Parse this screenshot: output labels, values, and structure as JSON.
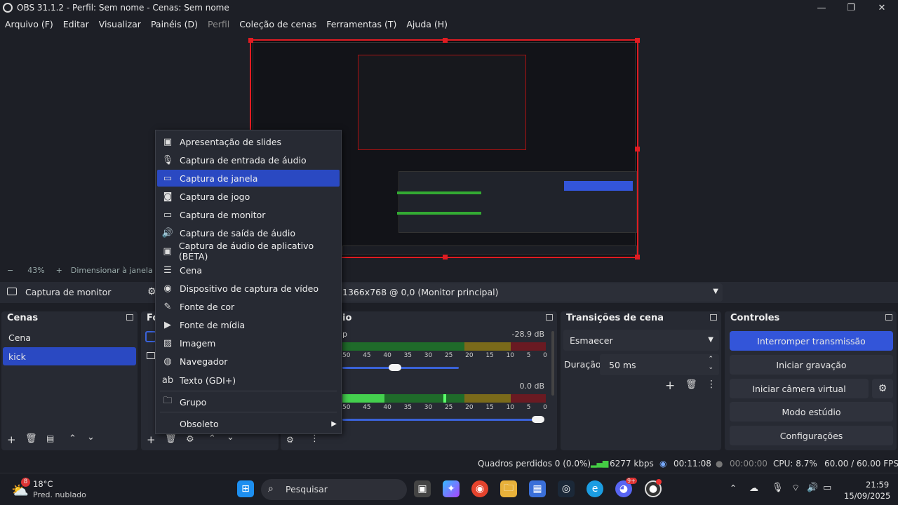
{
  "window": {
    "title": "OBS 31.1.2 - Perfil: Sem nome - Cenas: Sem nome"
  },
  "menubar": [
    "Arquivo (F)",
    "Editar",
    "Visualizar",
    "Painéis (D)",
    "Perfil",
    "Coleção de cenas",
    "Ferramentas (T)",
    "Ajuda (H)"
  ],
  "zoom": {
    "minus": "−",
    "percent": "43%",
    "plus": "+",
    "fit_label": "Dimensionar à janela"
  },
  "source_bar": {
    "source_name": "Captura de monitor",
    "monitor": "1366x768 @ 0,0 (Monitor principal)"
  },
  "scenes": {
    "title": "Cenas",
    "items": [
      "Cena",
      "kick"
    ],
    "selected": "kick"
  },
  "sources": {
    "title": "Fo"
  },
  "mixer": {
    "title": "io",
    "tracks": [
      {
        "name": "p",
        "db": "-28.9 dB",
        "volume": 0.35
      },
      {
        "name": "",
        "db": "0.0 dB",
        "volume": 1.0
      }
    ],
    "scale": [
      "50",
      "45",
      "40",
      "35",
      "30",
      "25",
      "20",
      "15",
      "10",
      "5",
      "0"
    ]
  },
  "transitions": {
    "title": "Transições de cena",
    "selected": "Esmaecer",
    "duration_label": "Duração",
    "duration_value": "50 ms"
  },
  "controls": {
    "title": "Controles",
    "buttons": [
      "Interromper transmissão",
      "Iniciar gravação",
      "Iniciar câmera virtual",
      "Modo estúdio",
      "Configurações"
    ]
  },
  "context_menu": {
    "items": [
      {
        "label": "Apresentação de slides",
        "icon": "slideshow-icon"
      },
      {
        "label": "Captura de entrada de áudio",
        "icon": "microphone-icon"
      },
      {
        "label": "Captura de janela",
        "icon": "window-icon",
        "highlighted": true
      },
      {
        "label": "Captura de jogo",
        "icon": "gamepad-icon"
      },
      {
        "label": "Captura de monitor",
        "icon": "monitor-icon"
      },
      {
        "label": "Captura de saída de áudio",
        "icon": "speaker-icon"
      },
      {
        "label": "Captura de áudio de aplicativo (BETA)",
        "icon": "app-audio-icon"
      },
      {
        "label": "Cena",
        "icon": "list-icon"
      },
      {
        "label": "Dispositivo de captura de vídeo",
        "icon": "camera-icon"
      },
      {
        "label": "Fonte de cor",
        "icon": "brush-icon"
      },
      {
        "label": "Fonte de mídia",
        "icon": "play-icon"
      },
      {
        "label": "Imagem",
        "icon": "image-icon"
      },
      {
        "label": "Navegador",
        "icon": "globe-icon"
      },
      {
        "label": "Texto (GDI+)",
        "icon": "text-icon"
      },
      {
        "label": "Grupo",
        "icon": "folder-icon"
      },
      {
        "label": "Obsoleto",
        "icon": "submenu-arrow-icon"
      }
    ]
  },
  "status": {
    "dropped": "Quadros perdidos 0 (0.0%)",
    "kbps": "6277 kbps",
    "stream_time": "00:11:08",
    "rec_time": "00:00:00",
    "cpu": "CPU: 8.7%",
    "fps": "60.00 / 60.00 FPS"
  },
  "taskbar": {
    "weather_temp": "18°C",
    "weather_desc": "Pred. nublado",
    "weather_badge": "8",
    "search_placeholder": "Pesquisar",
    "time": "21:59",
    "date": "15/09/2025",
    "discord_badge": "9+"
  },
  "colors": {
    "accent": "#2a49c2",
    "selection_red": "#e01c22",
    "bg": "#1d1f26",
    "panel": "#272a33"
  }
}
